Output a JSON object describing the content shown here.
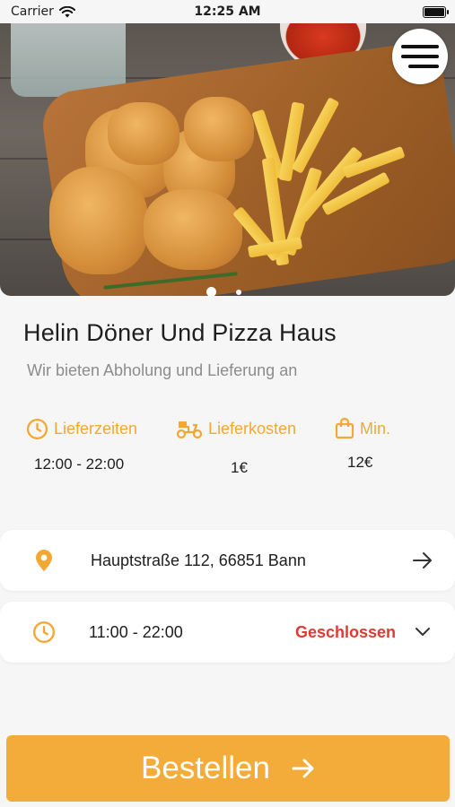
{
  "status_bar": {
    "carrier": "Carrier",
    "time": "12:25 AM"
  },
  "restaurant": {
    "name": "Helin Döner Und Pizza Haus",
    "tagline": "Wir bieten Abholung und Lieferung an"
  },
  "stats": [
    {
      "label": "Lieferzeiten",
      "value": "12:00 - 22:00",
      "icon": "clock-icon"
    },
    {
      "label": "Lieferkosten",
      "value": "1€",
      "icon": "scooter-icon"
    },
    {
      "label": "Min.",
      "value": "12€",
      "icon": "shopping-bag-icon"
    }
  ],
  "address_card": {
    "text": "Hauptstraße 112, 66851 Bann",
    "icon": "location-pin-icon",
    "end_icon": "arrow-right-icon"
  },
  "hours_card": {
    "text": "11:00 - 22:00",
    "status": "Geschlossen",
    "icon": "clock-icon",
    "end_icon": "chevron-down-icon"
  },
  "order_button": {
    "label": "Bestellen"
  },
  "carousel": {
    "current": 1,
    "total": 2
  },
  "colors": {
    "accent": "#f3ab3a",
    "closed": "#e03a32",
    "text": "#1e1e1e",
    "muted": "#8c8c8c"
  }
}
